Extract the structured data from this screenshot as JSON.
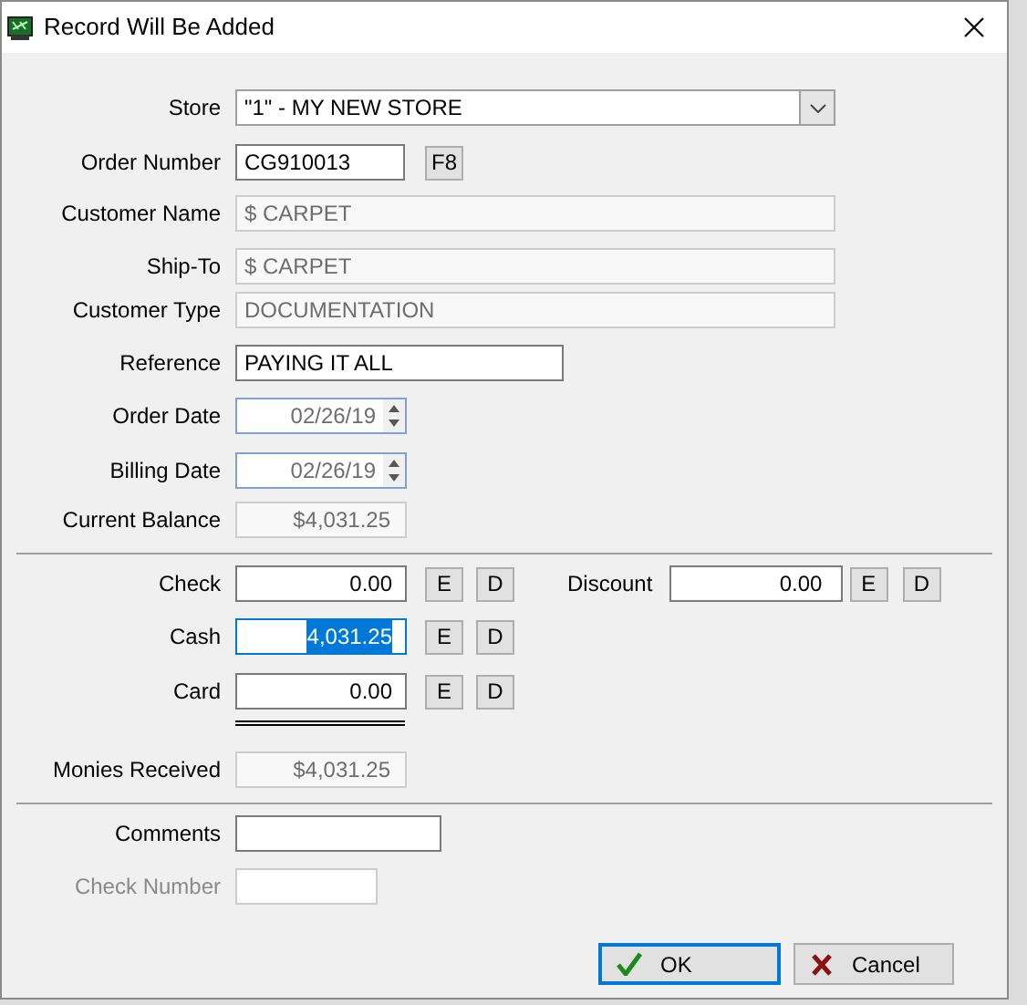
{
  "window": {
    "title": "Record Will Be Added"
  },
  "header_fields": [
    {
      "label": "Store",
      "kind": "dropdown",
      "value": "\"1\" - MY NEW STORE"
    },
    {
      "label": "Order Number",
      "kind": "text",
      "value": "CG910013",
      "button": "F8"
    },
    {
      "label": "Customer Name",
      "kind": "readonly",
      "value": "$ CARPET"
    },
    {
      "label": "Ship-To",
      "kind": "readonly",
      "value": "$ CARPET"
    },
    {
      "label": "Customer Type",
      "kind": "readonly",
      "value": "DOCUMENTATION"
    },
    {
      "label": "Reference",
      "kind": "text",
      "value": "PAYING IT ALL"
    },
    {
      "label": "Order Date",
      "kind": "date",
      "value": "02/26/19"
    },
    {
      "label": "Billing Date",
      "kind": "date",
      "value": "02/26/19"
    },
    {
      "label": "Current Balance",
      "kind": "amount",
      "value": "$4,031.25"
    }
  ],
  "payments": [
    {
      "label": "Check",
      "value": "0.00",
      "buttons": [
        "E",
        "D"
      ],
      "selected": false
    },
    {
      "label": "Cash",
      "value": "4,031.25",
      "buttons": [
        "E",
        "D"
      ],
      "selected": true
    },
    {
      "label": "Card",
      "value": "0.00",
      "buttons": [
        "E",
        "D"
      ],
      "selected": false
    }
  ],
  "discount": {
    "label": "Discount",
    "value": "0.00",
    "buttons": [
      "E",
      "D"
    ]
  },
  "monies_received": {
    "label": "Monies Received",
    "value": "$4,031.25"
  },
  "comments": {
    "label": "Comments"
  },
  "check_number": {
    "label": "Check Number",
    "disabled": true
  },
  "buttons": [
    {
      "label": "OK",
      "kind": "ok",
      "focused": true
    },
    {
      "label": "Cancel",
      "kind": "cancel",
      "focused": false
    }
  ]
}
